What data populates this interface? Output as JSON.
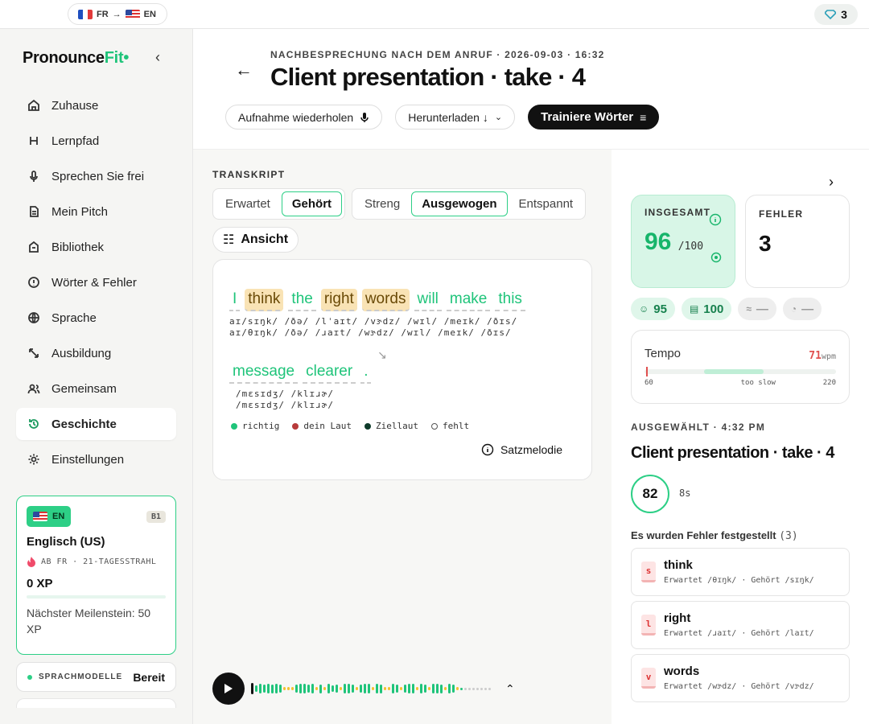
{
  "topbar": {
    "lang_from": "FR",
    "lang_to": "EN",
    "gems": "3"
  },
  "brand": {
    "name_a": "Pronounce",
    "name_b": "Fit",
    "accent": "#1fc47a"
  },
  "nav": [
    {
      "label": "Zuhause",
      "icon": "home-icon"
    },
    {
      "label": "Lernpfad",
      "icon": "path-icon"
    },
    {
      "label": "Sprechen Sie frei",
      "icon": "mic-icon"
    },
    {
      "label": "Mein Pitch",
      "icon": "document-icon"
    },
    {
      "label": "Bibliothek",
      "icon": "library-icon"
    },
    {
      "label": "Wörter & Fehler",
      "icon": "alert-icon"
    },
    {
      "label": "Sprache",
      "icon": "globe-icon"
    },
    {
      "label": "Ausbildung",
      "icon": "training-icon"
    },
    {
      "label": "Gemeinsam",
      "icon": "people-icon"
    },
    {
      "label": "Geschichte",
      "icon": "history-icon",
      "active": true
    },
    {
      "label": "Einstellungen",
      "icon": "gear-icon"
    }
  ],
  "lang_card": {
    "badge": "EN",
    "level": "B1",
    "name": "Englisch (US)",
    "streak": "AB FR · 21-TAGESSTRAHL",
    "xp": "0 XP",
    "milestone": "Nächster Meilenstein: 50 XP"
  },
  "models": {
    "label": "SPRACHMODELLE",
    "status": "Bereit"
  },
  "header": {
    "eyebrow": "NACHBESPRECHUNG NACH DEM ANRUF · 2026-09-03 · 16:32",
    "title": "Client presentation · take · 4",
    "btn_repeat": "Aufnahme wiederholen",
    "btn_download": "Herunterladen ↓",
    "btn_train": "Trainiere Wörter"
  },
  "transcript": {
    "label": "TRANSKRIPT",
    "tabs": [
      "Erwartet",
      "Gehört"
    ],
    "modes": [
      "Streng",
      "Ausgewogen",
      "Entspannt"
    ],
    "view": "Ansicht",
    "line1": [
      {
        "w": "I",
        "err": false
      },
      {
        "w": "think",
        "err": true
      },
      {
        "w": "the",
        "err": false
      },
      {
        "w": "right",
        "err": true
      },
      {
        "w": "words",
        "err": true
      },
      {
        "w": "will",
        "err": false
      },
      {
        "w": "make",
        "err": false
      },
      {
        "w": "this",
        "err": false
      }
    ],
    "line2": [
      {
        "w": "message",
        "err": false
      },
      {
        "w": "clearer",
        "err": false
      },
      {
        "w": ".",
        "err": false
      }
    ],
    "ipa1a": "aɪ/sɪŋk/ /ðə/ /lˈaɪt/ /vɝdz/ /wɪl/ /meɪk/ /ðɪs/",
    "ipa1b": "aɪ/θɪŋk/ /ðə/ /ɹaɪt/ /wɝdz/ /wɪl/ /meɪk/ /ðɪs/",
    "ipa2a": "/mɛsɪdʒ/  /klɪɹɚ/",
    "ipa2b": "/mɛsɪdʒ/  /klɪɹɚ/",
    "legend": [
      "richtig",
      "dein Laut",
      "Ziellaut",
      "fehlt"
    ],
    "melodie": "Satzmelodie"
  },
  "summary": {
    "overall_label": "INSGESAMT",
    "overall": "96",
    "overall_max": "/100",
    "errors_label": "FEHLER",
    "errors": "3",
    "chips": [
      "95",
      "100",
      "—",
      "—"
    ],
    "tempo_label": "Tempo",
    "tempo_value": "71",
    "tempo_unit": "wpm",
    "tempo_min": "60",
    "tempo_zone": "too slow",
    "tempo_max": "220"
  },
  "selected": {
    "label": "AUSGEWÄHLT · 4:32 PM",
    "title": "Client presentation · take · 4",
    "score": "82",
    "duration": "8s",
    "found": "Es wurden Fehler festgestellt",
    "found_count": "(3)",
    "errors": [
      {
        "icon": "s",
        "word": "think",
        "detail": "Erwartet /θɪŋk/ · Gehört /sɪŋk/"
      },
      {
        "icon": "l",
        "word": "right",
        "detail": "Erwartet /ɹaɪt/ · Gehört /laɪt/"
      },
      {
        "icon": "v",
        "word": "words",
        "detail": "Erwartet /wɝdz/ · Gehört /vɝdz/"
      }
    ]
  }
}
